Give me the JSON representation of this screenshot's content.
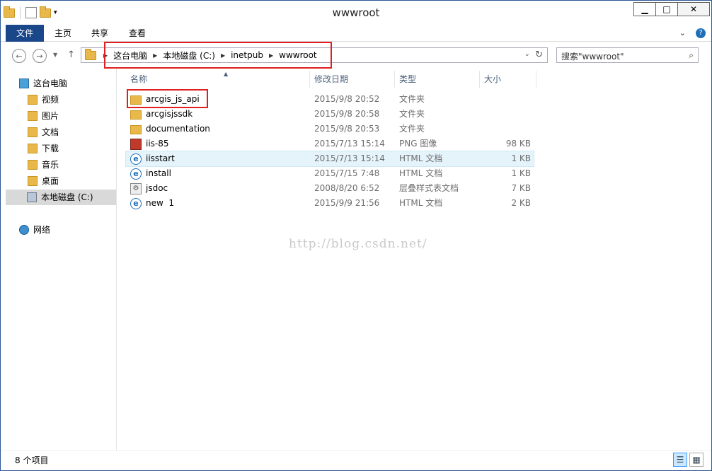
{
  "window": {
    "title": "wwwroot"
  },
  "ribbon": {
    "tabs": [
      "文件",
      "主页",
      "共享",
      "查看"
    ]
  },
  "address": {
    "crumbs": [
      "这台电脑",
      "本地磁盘 (C:)",
      "inetpub",
      "wwwroot"
    ]
  },
  "search": {
    "placeholder": "搜索\"wwwroot\""
  },
  "nav": {
    "items": [
      {
        "label": "这台电脑",
        "icon": "computer-icon"
      },
      {
        "label": "视频",
        "icon": "videos-folder-icon"
      },
      {
        "label": "图片",
        "icon": "pictures-folder-icon"
      },
      {
        "label": "文档",
        "icon": "documents-folder-icon"
      },
      {
        "label": "下载",
        "icon": "downloads-folder-icon"
      },
      {
        "label": "音乐",
        "icon": "music-folder-icon"
      },
      {
        "label": "桌面",
        "icon": "desktop-folder-icon"
      },
      {
        "label": "本地磁盘 (C:)",
        "icon": "local-disk-icon"
      },
      {
        "label": "网络",
        "icon": "network-icon"
      }
    ]
  },
  "columns": {
    "name": "名称",
    "date": "修改日期",
    "type": "类型",
    "size": "大小"
  },
  "files": [
    {
      "name": "arcgis_js_api",
      "date": "2015/9/8 20:52",
      "type": "文件夹",
      "size": "",
      "icon": "folder-icon"
    },
    {
      "name": "arcgisjssdk",
      "date": "2015/9/8 20:58",
      "type": "文件夹",
      "size": "",
      "icon": "folder-icon"
    },
    {
      "name": "documentation",
      "date": "2015/9/8 20:53",
      "type": "文件夹",
      "size": "",
      "icon": "folder-icon"
    },
    {
      "name": "iis-85",
      "date": "2015/7/13 15:14",
      "type": "PNG 图像",
      "size": "98 KB",
      "icon": "png-image-icon"
    },
    {
      "name": "iisstart",
      "date": "2015/7/13 15:14",
      "type": "HTML 文档",
      "size": "1 KB",
      "icon": "html-document-icon"
    },
    {
      "name": "install",
      "date": "2015/7/15 7:48",
      "type": "HTML 文档",
      "size": "1 KB",
      "icon": "html-document-icon"
    },
    {
      "name": "jsdoc",
      "date": "2008/8/20 6:52",
      "type": "层叠样式表文档",
      "size": "7 KB",
      "icon": "css-document-icon"
    },
    {
      "name": "new  1",
      "date": "2015/9/9 21:56",
      "type": "HTML 文档",
      "size": "2 KB",
      "icon": "html-document-icon"
    }
  ],
  "watermark": "http://blog.csdn.net/",
  "status": {
    "count": "8 个项目"
  },
  "colors": {
    "file_tab": "#19478a",
    "highlight_box": "#e02020",
    "hover_row": "#e5f3fb"
  }
}
